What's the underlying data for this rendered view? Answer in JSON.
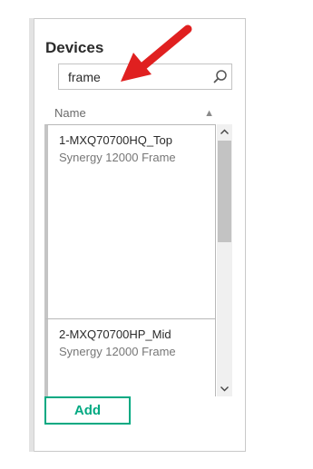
{
  "panel": {
    "title": "Devices"
  },
  "search": {
    "value": "frame",
    "icon": "search-icon"
  },
  "table": {
    "column_header": "Name",
    "sort_indicator": "▲",
    "items": [
      {
        "name": "1-MXQ70700HQ_Top",
        "type": "Synergy 12000 Frame"
      },
      {
        "name": "2-MXQ70700HP_Mid",
        "type": "Synergy 12000 Frame"
      }
    ]
  },
  "actions": {
    "add_label": "Add"
  },
  "colors": {
    "accent": "#01a982",
    "annotation_arrow": "#e02020"
  }
}
